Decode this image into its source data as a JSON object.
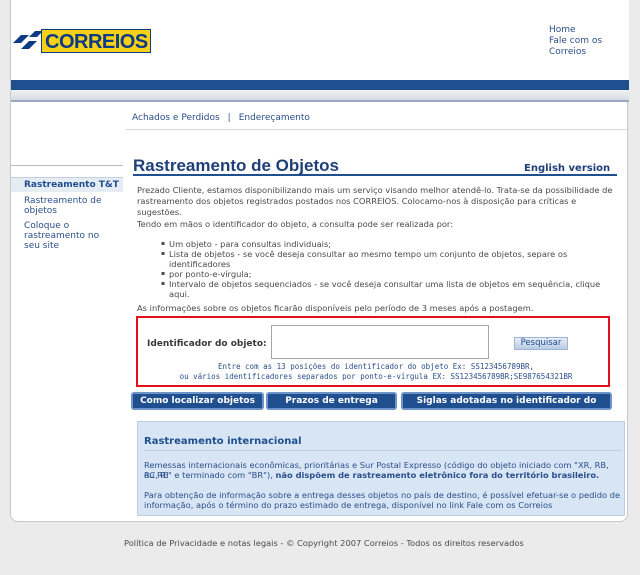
{
  "header": {
    "logo_text": "CORREIOS",
    "links": [
      "Home",
      "Fale com os",
      "Correios"
    ]
  },
  "subnav": {
    "items": [
      "Achados e Perdidos",
      "Endereçamento"
    ],
    "separator": "|"
  },
  "sidebar": {
    "heading": "Rastreamento T&T",
    "items": [
      "Rastreamento de",
      "objetos",
      "Coloque o",
      "rastreamento no",
      "seu site"
    ]
  },
  "main": {
    "title": "Rastreamento de Objetos",
    "english_link": "English version",
    "intro_1": "Prezado Cliente, estamos disponibilizando mais um serviço visando melhor atendê-lo. Trata-se da possibilidade de",
    "intro_2": "rastreamento dos objetos registrados postados nos CORREIOS. Colocamo-nos à disposição para críticas e sugestões.",
    "lead": "Tendo em mãos o identificador do objeto, a consulta pode ser realizada por:",
    "bullets": [
      "Um objeto - para consultas individuais;",
      "Lista de objetos - se você deseja consultar ao mesmo tempo um conjunto de objetos, separe os identificadores",
      "por ponto-e-vírgula;",
      "Intervalo de objetos sequenciados - se você deseja consultar uma lista de objetos em sequência, clique aqui."
    ],
    "availability": "As informações sobre os objetos ficarão disponíveis pelo período de 3 meses após a postagem."
  },
  "form": {
    "label": "Identificador do objeto:",
    "value": "",
    "search_button": "Pesquisar",
    "hint_1": "Entre com as 13 posições do identificador do objeto Ex: SS123456789BR,",
    "hint_2": "ou vários identificadores separados por ponto-e-vírgula EX: SS123456789BR;SE987654321BR"
  },
  "buttons": {
    "how_to": "Como localizar objetos",
    "deadlines": "Prazos de entrega",
    "acronyms": "Siglas adotadas no identificador do objeto"
  },
  "international": {
    "title": "Rastreamento internacional",
    "p1_line1": "Remessas internacionais econômicas, prioritárias e Sur Postal Expresso (código do objeto iniciado com \"XR, RB, RC, RI",
    "p1_line2_a": "ou RE\" e terminado com \"BR\"),",
    "p1_line2_b": "não dispõem de rastreamento eletrônico fora do território brasileiro.",
    "p2_line1": "Para obtenção de informação sobre a entrega desses objetos no país de destino, é possível efetuar-se o pedido de",
    "p2_line2_a": "informação, após o término do prazo estimado de entrega, disponível no link",
    "p2_link": "Fale com os Correios"
  },
  "footer": {
    "text": "Política de Privacidade e notas legais - © Copyright 2007 Correios - Todos os direitos reservados"
  },
  "colors": {
    "brand_blue": "#1f4f8f",
    "brand_yellow": "#f7d117",
    "highlight_red": "#e0111b"
  }
}
